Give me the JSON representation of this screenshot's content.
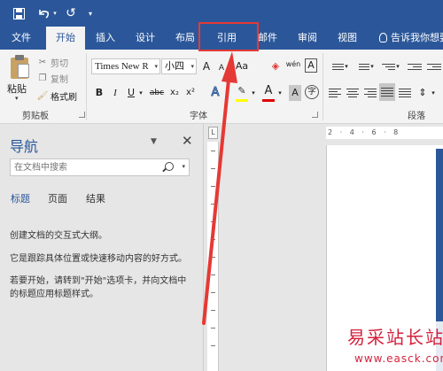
{
  "tabs": [
    {
      "label": "文件",
      "active": false
    },
    {
      "label": "开始",
      "active": true
    },
    {
      "label": "插入",
      "active": false
    },
    {
      "label": "设计",
      "active": false
    },
    {
      "label": "布局",
      "active": false
    },
    {
      "label": "引用",
      "active": false
    },
    {
      "label": "邮件",
      "active": false
    },
    {
      "label": "审阅",
      "active": false
    },
    {
      "label": "视图",
      "active": false
    }
  ],
  "tell_me": "告诉我你想要",
  "clipboard": {
    "paste": "粘贴",
    "cut": "剪切",
    "copy": "复制",
    "format_painter": "格式刷",
    "group_label": "剪贴板"
  },
  "font": {
    "name": "Times New R",
    "size": "小四",
    "group_label": "字体",
    "bold": "B",
    "italic": "I",
    "underline": "U",
    "strike": "abc",
    "subscript": "x₂",
    "superscript": "x²",
    "grow": "A",
    "shrink": "A",
    "case": "Aa",
    "phonetic": "wén",
    "char_border": "A",
    "text_effect": "A",
    "font_color": "A",
    "char_shade": "A",
    "encircle": "字",
    "highlight_color": "#ffff00",
    "font_color_value": "#e00000"
  },
  "paragraph": {
    "group_label": "段落"
  },
  "nav": {
    "title": "导航",
    "search_placeholder": "在文档中搜索",
    "tabs": [
      "标题",
      "页面",
      "结果"
    ],
    "line1": "创建文档的交互式大纲。",
    "line2": "它是跟踪具体位置或快速移动内容的好方式。",
    "line3a": "若要开始，请转到\"开始\"选项卡，并向文档中",
    "line3b": "的标题应用标题样式。"
  },
  "ruler": {
    "corner": "L",
    "marks": "2 · 4 · 6 · 8"
  },
  "watermark": {
    "text": "易采站长站",
    "url": "www.easck.com"
  },
  "colors": {
    "brand": "#2b579a",
    "annotation": "#e53935"
  }
}
